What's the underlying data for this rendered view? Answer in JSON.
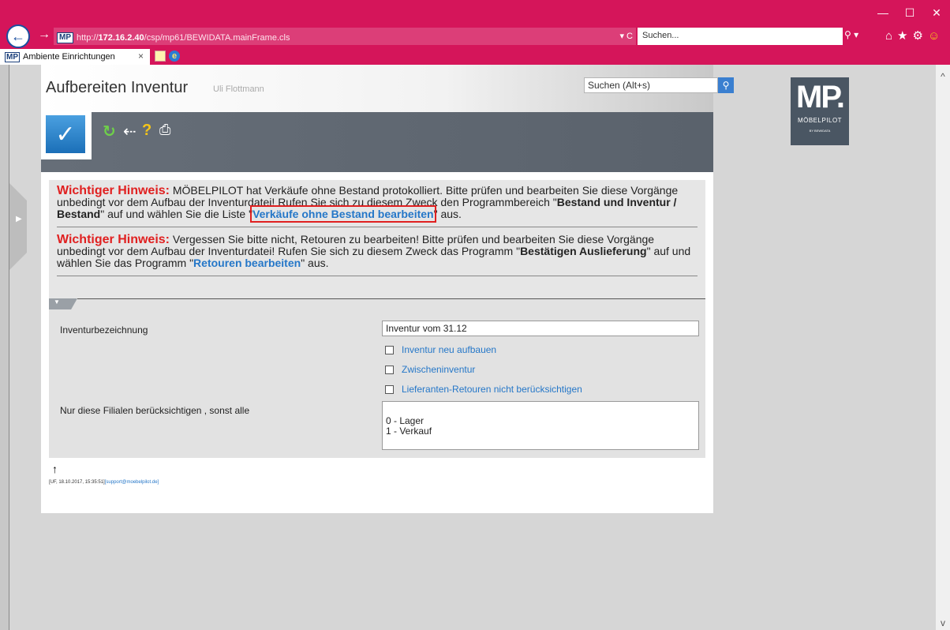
{
  "browser": {
    "url_prefix": "http://",
    "url_host": "172.16.2.40",
    "url_path": "/csp/mp61/BEWIDATA.mainFrame.cls",
    "addr_tools": "▾ C",
    "search_placeholder": "Suchen...",
    "search_icon": "⚲ ▾",
    "tab_title": "Ambiente Einrichtungen",
    "tab_close": "×",
    "mp_badge": "MP",
    "win_minimize": "—",
    "win_maximize": "☐",
    "win_close": "✕",
    "back": "←",
    "forward": "→",
    "tool_icons": "⌂★⚙",
    "smiley": "☺"
  },
  "app": {
    "title": "Aufbereiten Inventur",
    "user": "Uli Flottmann",
    "search_value": "Suchen (Alt+s)",
    "search_btn": "⚲",
    "toolbar": {
      "confirm": "✓",
      "refresh": "↻",
      "back": "⇠",
      "help": "?",
      "print": "⎙"
    },
    "logo": {
      "mark": "MP.",
      "name": "MÖBELPILOT",
      "sub": "BY BEWIDATA"
    }
  },
  "notices": [
    {
      "label": "Wichtiger Hinweis:",
      "text1": " MÖBELPILOT hat Verkäufe ohne Bestand protokolliert. Bitte prüfen und bearbeiten Sie diese Vorgänge unbedingt vor dem Aufbau der Inventurdatei! Rufen Sie sich zu diesem Zweck den Programmbereich \"",
      "bold1": "Bestand und Inventur / Bestand",
      "text2": "\" auf und wählen Sie die Liste \"",
      "link": "Verkäufe ohne Bestand bearbeiten",
      "text3": "\" aus."
    },
    {
      "label": "Wichtiger Hinweis:",
      "text1": " Vergessen Sie bitte nicht, Retouren zu bearbeiten! Bitte prüfen und bearbeiten Sie diese Vorgänge unbedingt vor dem Aufbau der Inventurdatei! Rufen Sie sich zu diesem Zweck das Programm \"",
      "bold1": "Bestätigen Auslieferung",
      "text2": "\" auf und wählen Sie das Programm \"",
      "link": "Retouren bearbeiten",
      "text3": "\" aus."
    }
  ],
  "form": {
    "inventur_label": "Inventurbezeichnung",
    "inventur_value": "Inventur vom 31.12",
    "checkboxes": [
      {
        "label": "Inventur neu aufbauen",
        "checked": false
      },
      {
        "label": "Zwischeninventur",
        "checked": false
      },
      {
        "label": "Lieferanten-Retouren nicht berücksichtigen",
        "checked": false
      }
    ],
    "filialen_label": "Nur diese Filialen berücksichtigen , sonst alle",
    "filialen_options": [
      "0 - Lager",
      "1 - Verkauf"
    ]
  },
  "footer": {
    "up_arrow": "🡑",
    "info": "[UF, 18.10.2017, 15:35:51]",
    "support": "[support@moebelpilot.de]"
  },
  "scrollbar": {
    "up": "^",
    "down": "v"
  }
}
